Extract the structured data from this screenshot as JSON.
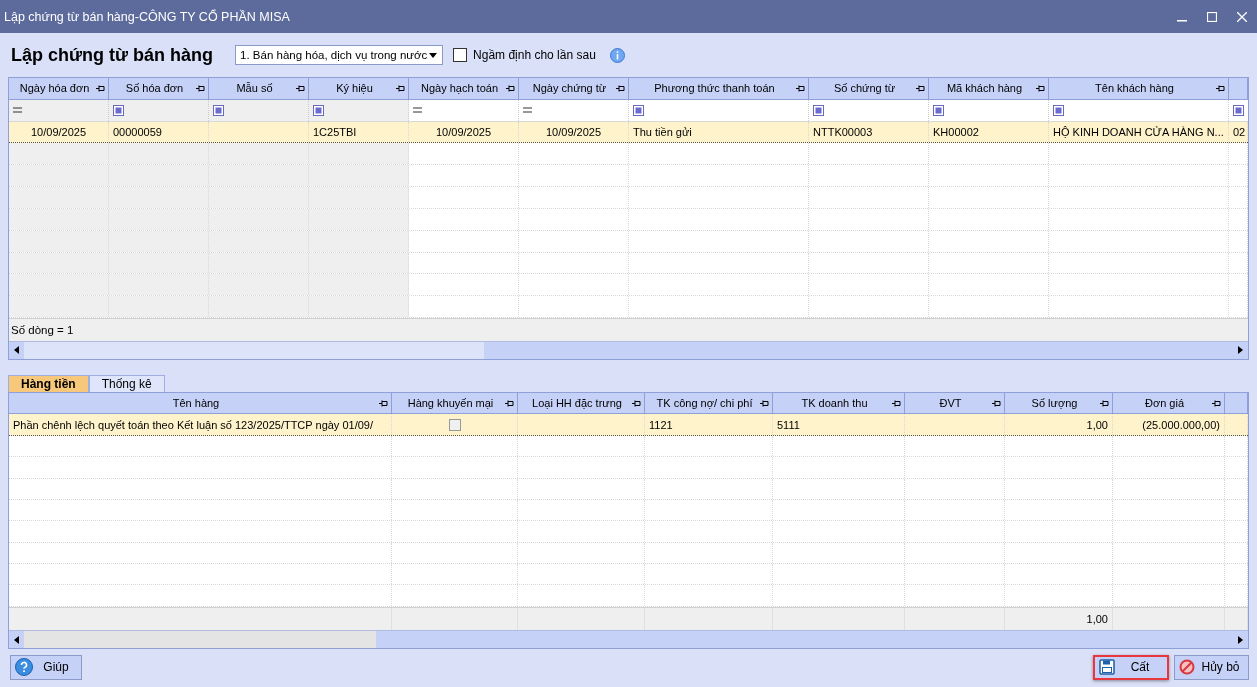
{
  "window": {
    "title": "Lập chứng từ bán hàng-CÔNG TY CỔ PHẦN MISA"
  },
  "header": {
    "title": "Lập chứng từ bán hàng",
    "voucher_type": "1. Bán hàng hóa, dịch vụ trong nước",
    "default_checkbox": {
      "label": "Ngầm định cho lần sau",
      "checked": false
    }
  },
  "voucher_grid": {
    "columns": [
      {
        "label": "Ngày hóa đơn",
        "kind": "equals",
        "readonly": true
      },
      {
        "label": "Số hóa đơn",
        "kind": "box",
        "readonly": true
      },
      {
        "label": "Mẫu số",
        "kind": "box",
        "readonly": true
      },
      {
        "label": "Ký hiệu",
        "kind": "box",
        "readonly": true
      },
      {
        "label": "Ngày hạch toán",
        "kind": "equals",
        "readonly": false
      },
      {
        "label": "Ngày chứng từ",
        "kind": "equals",
        "readonly": false
      },
      {
        "label": "Phương thức thanh toán",
        "kind": "box",
        "readonly": false
      },
      {
        "label": "Số chứng từ",
        "kind": "box",
        "readonly": false
      },
      {
        "label": "Mã khách hàng",
        "kind": "box",
        "readonly": false
      },
      {
        "label": "Tên khách hàng",
        "kind": "box",
        "readonly": false
      },
      {
        "kind": "box",
        "readonly": false
      }
    ],
    "rows": [
      {
        "selected": true,
        "cells": [
          "10/09/2025",
          "00000059",
          "",
          "1C25TBI",
          "10/09/2025",
          "10/09/2025",
          "Thu tiền gửi",
          "NTTK00003",
          "KH00002",
          "HỘ KINH DOANH CỬA HÀNG N...",
          "02"
        ]
      }
    ],
    "row_count": "Số dòng = 1"
  },
  "tabs": [
    {
      "label": "Hàng tiền",
      "selected": true
    },
    {
      "label": "Thống kê",
      "selected": false
    }
  ],
  "items_grid": {
    "columns": [
      "Tên hàng",
      "Hàng khuyến mại",
      "Loại HH đặc trưng",
      "TK công nợ/ chi phí",
      "TK doanh thu",
      "ĐVT",
      "Số lượng",
      "Đơn giá"
    ],
    "rows": [
      {
        "selected": true,
        "promo": false,
        "cells": [
          "Phần chênh lệch quyết toán theo Kết luận số 123/2025/TTCP ngày 01/09/",
          "",
          "",
          "1121",
          "5111",
          "",
          "1,00",
          "(25.000.000,00)"
        ]
      }
    ],
    "total_quantity": "1,00"
  },
  "buttons": [
    {
      "kind": "help",
      "label": "Giúp",
      "highlighted": false
    },
    {
      "kind": "save",
      "label": "Cất",
      "highlighted": true
    },
    {
      "kind": "cancel",
      "label": "Hủy bỏ",
      "highlighted": false
    }
  ]
}
